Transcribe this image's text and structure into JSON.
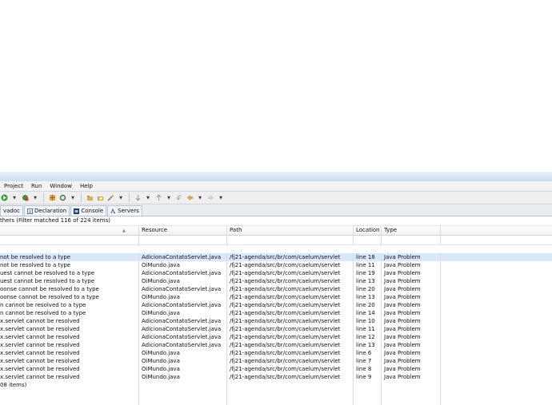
{
  "menu": [
    "Project",
    "Run",
    "Window",
    "Help"
  ],
  "toolbar_icons": [
    "run-icon",
    "dropdown-arrow-icon",
    "debug-icon",
    "dropdown-arrow-icon",
    "separator",
    "grid-icon",
    "refresh-icon",
    "dropdown-arrow-icon",
    "separator",
    "open-folder-icon",
    "folder-icon",
    "wand-icon",
    "dropdown-arrow-icon",
    "separator",
    "annotation-next-icon",
    "dropdown-arrow-icon",
    "annotation-prev-icon",
    "dropdown-arrow-icon",
    "back-nav-icon",
    "back-icon",
    "dropdown-arrow-icon",
    "forward-icon",
    "dropdown-arrow-icon"
  ],
  "tabs": [
    {
      "label": "vadoc",
      "icon": "javadoc-icon"
    },
    {
      "label": "Declaration",
      "icon": "declaration-icon"
    },
    {
      "label": "Console",
      "icon": "console-icon"
    },
    {
      "label": "Servers",
      "icon": "servers-icon"
    }
  ],
  "filter_status": "thers (Filter matched 116 of 224 items)",
  "columns": {
    "description": "",
    "resource": "Resource",
    "path": "Path",
    "location": "Location",
    "type": "Type"
  },
  "rows": [
    {
      "description": "not be resolved to a type",
      "resource": "AdicionaContatoServlet.java",
      "path": "/fj21-agenda/src/br/com/caelum/servlet",
      "location": "line 18",
      "type": "Java Problem"
    },
    {
      "description": "not be resolved to a type",
      "resource": "OiMundo.java",
      "path": "/fj21-agenda/src/br/com/caelum/servlet",
      "location": "line 11",
      "type": "Java Problem"
    },
    {
      "description": "uest cannot be resolved to a type",
      "resource": "AdicionaContatoServlet.java",
      "path": "/fj21-agenda/src/br/com/caelum/servlet",
      "location": "line 19",
      "type": "Java Problem"
    },
    {
      "description": "uest cannot be resolved to a type",
      "resource": "OiMundo.java",
      "path": "/fj21-agenda/src/br/com/caelum/servlet",
      "location": "line 13",
      "type": "Java Problem"
    },
    {
      "description": "oonse cannot be resolved to a type",
      "resource": "AdicionaContatoServlet.java",
      "path": "/fj21-agenda/src/br/com/caelum/servlet",
      "location": "line 20",
      "type": "Java Problem"
    },
    {
      "description": "oonse cannot be resolved to a type",
      "resource": "OiMundo.java",
      "path": "/fj21-agenda/src/br/com/caelum/servlet",
      "location": "line 13",
      "type": "Java Problem"
    },
    {
      "description": "n cannot be resolved to a type",
      "resource": "AdicionaContatoServlet.java",
      "path": "/fj21-agenda/src/br/com/caelum/servlet",
      "location": "line 20",
      "type": "Java Problem"
    },
    {
      "description": "n cannot be resolved to a type",
      "resource": "OiMundo.java",
      "path": "/fj21-agenda/src/br/com/caelum/servlet",
      "location": "line 14",
      "type": "Java Problem"
    },
    {
      "description": "x.servlet cannot be resolved",
      "resource": "AdicionaContatoServlet.java",
      "path": "/fj21-agenda/src/br/com/caelum/servlet",
      "location": "line 10",
      "type": "Java Problem"
    },
    {
      "description": "x.servlet cannot be resolved",
      "resource": "AdicionaContatoServlet.java",
      "path": "/fj21-agenda/src/br/com/caelum/servlet",
      "location": "line 11",
      "type": "Java Problem"
    },
    {
      "description": "x.servlet cannot be resolved",
      "resource": "AdicionaContatoServlet.java",
      "path": "/fj21-agenda/src/br/com/caelum/servlet",
      "location": "line 12",
      "type": "Java Problem"
    },
    {
      "description": "x.servlet cannot be resolved",
      "resource": "AdicionaContatoServlet.java",
      "path": "/fj21-agenda/src/br/com/caelum/servlet",
      "location": "line 13",
      "type": "Java Problem"
    },
    {
      "description": "x.servlet cannot be resolved",
      "resource": "OiMundo.java",
      "path": "/fj21-agenda/src/br/com/caelum/servlet",
      "location": "line 6",
      "type": "Java Problem"
    },
    {
      "description": "x.servlet cannot be resolved",
      "resource": "OiMundo.java",
      "path": "/fj21-agenda/src/br/com/caelum/servlet",
      "location": "line 7",
      "type": "Java Problem"
    },
    {
      "description": "x.servlet cannot be resolved",
      "resource": "OiMundo.java",
      "path": "/fj21-agenda/src/br/com/caelum/servlet",
      "location": "line 8",
      "type": "Java Problem"
    },
    {
      "description": "x.servlet cannot be resolved",
      "resource": "OiMundo.java",
      "path": "/fj21-agenda/src/br/com/caelum/servlet",
      "location": "line 9",
      "type": "Java Problem"
    }
  ],
  "summary_row": "08 items)",
  "selected_row_index": 0
}
